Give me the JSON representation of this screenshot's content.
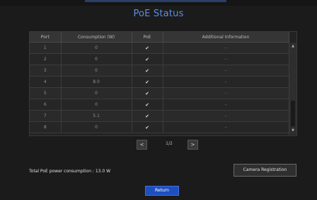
{
  "title": "PoE Status",
  "table": {
    "headers": [
      "Port",
      "Consumption (W)",
      "PoE",
      "Additional Information"
    ],
    "rows": [
      {
        "port": "1",
        "consumption": "0",
        "poe": "✔",
        "info": "–"
      },
      {
        "port": "2",
        "consumption": "0",
        "poe": "✔",
        "info": "–"
      },
      {
        "port": "3",
        "consumption": "0",
        "poe": "✔",
        "info": "–"
      },
      {
        "port": "4",
        "consumption": "8.0",
        "poe": "✔",
        "info": "–"
      },
      {
        "port": "5",
        "consumption": "0",
        "poe": "✔",
        "info": "–"
      },
      {
        "port": "6",
        "consumption": "0",
        "poe": "✔",
        "info": "–"
      },
      {
        "port": "7",
        "consumption": "5.1",
        "poe": "✔",
        "info": "–"
      },
      {
        "port": "8",
        "consumption": "0",
        "poe": "✔",
        "info": "–"
      }
    ]
  },
  "pager": {
    "prev": "<",
    "next": ">",
    "page": "1/2"
  },
  "total": "Total PoE power consumption : 13.0 W",
  "buttons": {
    "camera_registration": "Camera Registration",
    "return": "Return"
  },
  "scrollbar": {
    "up": "▲",
    "down": "▼"
  },
  "colors": {
    "title": "#5d8fe0",
    "return_button": "#1f4fbf",
    "background": "#1b1b1b"
  }
}
